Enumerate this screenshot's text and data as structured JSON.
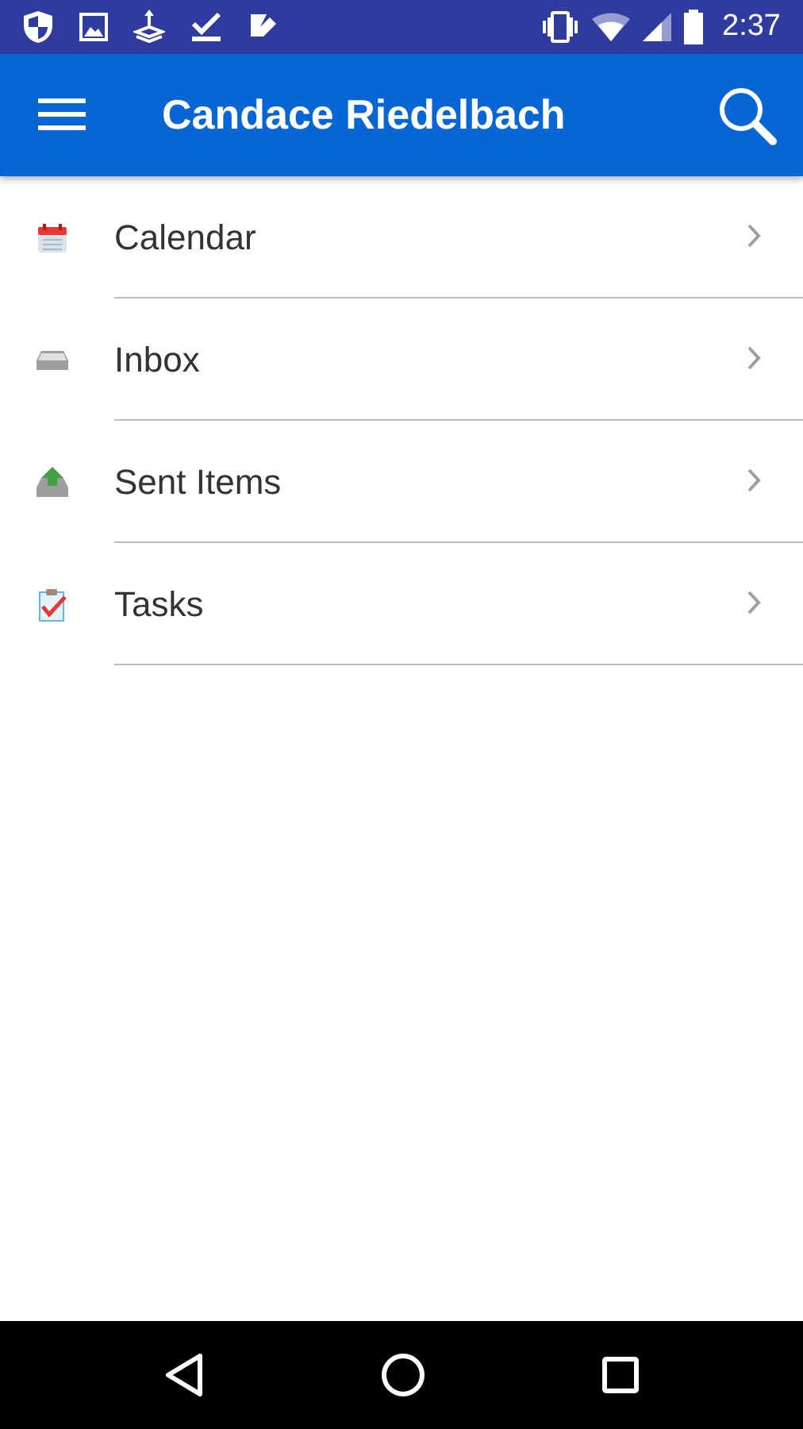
{
  "status_bar": {
    "time": "2:37"
  },
  "app_bar": {
    "title": "Candace Riedelbach"
  },
  "folders": [
    {
      "kind": "calendar",
      "label": "Calendar"
    },
    {
      "kind": "inbox",
      "label": "Inbox"
    },
    {
      "kind": "sent",
      "label": "Sent Items"
    },
    {
      "kind": "tasks",
      "label": "Tasks"
    }
  ]
}
